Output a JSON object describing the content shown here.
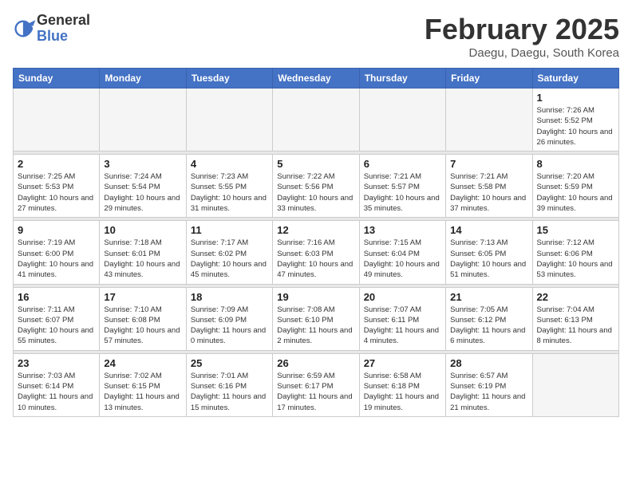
{
  "header": {
    "logo_general": "General",
    "logo_blue": "Blue",
    "month_title": "February 2025",
    "subtitle": "Daegu, Daegu, South Korea"
  },
  "weekdays": [
    "Sunday",
    "Monday",
    "Tuesday",
    "Wednesday",
    "Thursday",
    "Friday",
    "Saturday"
  ],
  "weeks": [
    [
      {
        "day": "",
        "empty": true
      },
      {
        "day": "",
        "empty": true
      },
      {
        "day": "",
        "empty": true
      },
      {
        "day": "",
        "empty": true
      },
      {
        "day": "",
        "empty": true
      },
      {
        "day": "",
        "empty": true
      },
      {
        "day": "1",
        "sunrise": "7:26 AM",
        "sunset": "5:52 PM",
        "daylight": "10 hours and 26 minutes."
      }
    ],
    [
      {
        "day": "2",
        "sunrise": "7:25 AM",
        "sunset": "5:53 PM",
        "daylight": "10 hours and 27 minutes."
      },
      {
        "day": "3",
        "sunrise": "7:24 AM",
        "sunset": "5:54 PM",
        "daylight": "10 hours and 29 minutes."
      },
      {
        "day": "4",
        "sunrise": "7:23 AM",
        "sunset": "5:55 PM",
        "daylight": "10 hours and 31 minutes."
      },
      {
        "day": "5",
        "sunrise": "7:22 AM",
        "sunset": "5:56 PM",
        "daylight": "10 hours and 33 minutes."
      },
      {
        "day": "6",
        "sunrise": "7:21 AM",
        "sunset": "5:57 PM",
        "daylight": "10 hours and 35 minutes."
      },
      {
        "day": "7",
        "sunrise": "7:21 AM",
        "sunset": "5:58 PM",
        "daylight": "10 hours and 37 minutes."
      },
      {
        "day": "8",
        "sunrise": "7:20 AM",
        "sunset": "5:59 PM",
        "daylight": "10 hours and 39 minutes."
      }
    ],
    [
      {
        "day": "9",
        "sunrise": "7:19 AM",
        "sunset": "6:00 PM",
        "daylight": "10 hours and 41 minutes."
      },
      {
        "day": "10",
        "sunrise": "7:18 AM",
        "sunset": "6:01 PM",
        "daylight": "10 hours and 43 minutes."
      },
      {
        "day": "11",
        "sunrise": "7:17 AM",
        "sunset": "6:02 PM",
        "daylight": "10 hours and 45 minutes."
      },
      {
        "day": "12",
        "sunrise": "7:16 AM",
        "sunset": "6:03 PM",
        "daylight": "10 hours and 47 minutes."
      },
      {
        "day": "13",
        "sunrise": "7:15 AM",
        "sunset": "6:04 PM",
        "daylight": "10 hours and 49 minutes."
      },
      {
        "day": "14",
        "sunrise": "7:13 AM",
        "sunset": "6:05 PM",
        "daylight": "10 hours and 51 minutes."
      },
      {
        "day": "15",
        "sunrise": "7:12 AM",
        "sunset": "6:06 PM",
        "daylight": "10 hours and 53 minutes."
      }
    ],
    [
      {
        "day": "16",
        "sunrise": "7:11 AM",
        "sunset": "6:07 PM",
        "daylight": "10 hours and 55 minutes."
      },
      {
        "day": "17",
        "sunrise": "7:10 AM",
        "sunset": "6:08 PM",
        "daylight": "10 hours and 57 minutes."
      },
      {
        "day": "18",
        "sunrise": "7:09 AM",
        "sunset": "6:09 PM",
        "daylight": "11 hours and 0 minutes."
      },
      {
        "day": "19",
        "sunrise": "7:08 AM",
        "sunset": "6:10 PM",
        "daylight": "11 hours and 2 minutes."
      },
      {
        "day": "20",
        "sunrise": "7:07 AM",
        "sunset": "6:11 PM",
        "daylight": "11 hours and 4 minutes."
      },
      {
        "day": "21",
        "sunrise": "7:05 AM",
        "sunset": "6:12 PM",
        "daylight": "11 hours and 6 minutes."
      },
      {
        "day": "22",
        "sunrise": "7:04 AM",
        "sunset": "6:13 PM",
        "daylight": "11 hours and 8 minutes."
      }
    ],
    [
      {
        "day": "23",
        "sunrise": "7:03 AM",
        "sunset": "6:14 PM",
        "daylight": "11 hours and 10 minutes."
      },
      {
        "day": "24",
        "sunrise": "7:02 AM",
        "sunset": "6:15 PM",
        "daylight": "11 hours and 13 minutes."
      },
      {
        "day": "25",
        "sunrise": "7:01 AM",
        "sunset": "6:16 PM",
        "daylight": "11 hours and 15 minutes."
      },
      {
        "day": "26",
        "sunrise": "6:59 AM",
        "sunset": "6:17 PM",
        "daylight": "11 hours and 17 minutes."
      },
      {
        "day": "27",
        "sunrise": "6:58 AM",
        "sunset": "6:18 PM",
        "daylight": "11 hours and 19 minutes."
      },
      {
        "day": "28",
        "sunrise": "6:57 AM",
        "sunset": "6:19 PM",
        "daylight": "11 hours and 21 minutes."
      },
      {
        "day": "",
        "empty": true
      }
    ]
  ]
}
